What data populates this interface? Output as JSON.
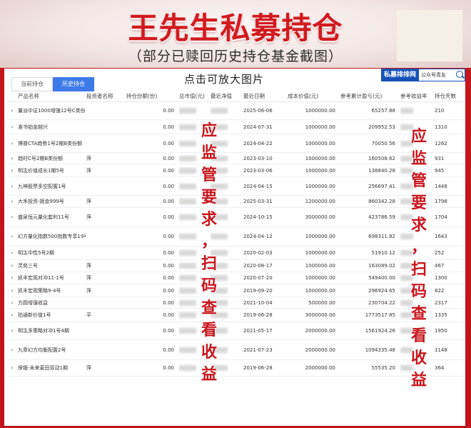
{
  "banner": {
    "title": "王先生私募持仓",
    "subtitle": "（部分已赎回历史持仓基金截图）"
  },
  "hint": "点击可放大图片",
  "tabs": [
    {
      "label": "当前持仓",
      "active": false
    },
    {
      "label": "历史持仓",
      "active": true
    }
  ],
  "search": {
    "logo": "私募排排网",
    "placeholder": "公众号青友"
  },
  "columns": [
    "产品名称",
    "投资者名称",
    "持仓份额(份)",
    "总市值(元)",
    "最近净值",
    "最近日期",
    "成本价值(元)",
    "参考累计盈亏(元)",
    "参考收益率",
    "持仓天数"
  ],
  "rows": [
    {
      "name": "量派中证1000增强12号C类份额",
      "investor": "",
      "shares": "0.00",
      "date": "2025-06-06",
      "cost": "1000000.00",
      "pnl": "65257.88",
      "days": "210"
    },
    {
      "name": "准书铂金越兴",
      "investor": "",
      "shares": "0.00",
      "date": "2024-07-31",
      "cost": "1000000.00",
      "pnl": "209952.53",
      "days": "1310"
    },
    {
      "name": "博普CTA趋势1号2期B类份额",
      "investor": "",
      "shares": "0.00",
      "date": "2024-04-22",
      "cost": "1000000.00",
      "pnl": "70050.56",
      "days": "1262"
    },
    {
      "name": "趋时C号2期B类份额",
      "investor": "萍",
      "shares": "0.00",
      "date": "2023-03-10",
      "cost": "1000000.00",
      "pnl": "160508.62",
      "days": "931"
    },
    {
      "name": "明汯价值成长1期5号",
      "investor": "萍",
      "shares": "0.00",
      "date": "2023-03-06",
      "cost": "1000000.00",
      "pnl": "138840.28",
      "days": "945"
    },
    {
      "name": "九坤股票多空配置1号",
      "investor": "",
      "shares": "0.00",
      "date": "2024-04-15",
      "cost": "1000000.00",
      "pnl": "256697.41",
      "days": "1448"
    },
    {
      "name": "大禾投资-掘金999号",
      "investor": "萍",
      "shares": "0.00",
      "date": "2025-03-31",
      "cost": "1200000.00",
      "pnl": "860342.28",
      "days": "1798"
    },
    {
      "name": "盛泉恒元量化套利11号",
      "investor": "萍",
      "shares": "0.00",
      "date": "2024-10-15",
      "cost": "3000000.00",
      "pnl": "423786.59",
      "days": "1704"
    },
    {
      "name": "幻方量化指数500指数专享19号1期",
      "investor": "",
      "shares": "0.00",
      "date": "2024-04-12",
      "cost": "1000000.00",
      "pnl": "698311.82",
      "days": "1643"
    },
    {
      "name": "明汯中性5号2期",
      "investor": "",
      "shares": "0.00",
      "date": "2020-02-03",
      "cost": "1000000.00",
      "pnl": "51910.12",
      "days": "252"
    },
    {
      "name": "灵奕三号",
      "investor": "萍",
      "shares": "0.00",
      "date": "2020-08-17",
      "cost": "1000000.00",
      "pnl": "163089.02",
      "days": "467"
    },
    {
      "name": "凯丰宏观对冲11-1号",
      "investor": "萍",
      "shares": "0.00",
      "date": "2020-07-20",
      "cost": "1000000.00",
      "pnl": "549400.00",
      "days": "1300"
    },
    {
      "name": "凯丰宏观策略9-4号",
      "investor": "萍",
      "shares": "0.00",
      "date": "2019-09-20",
      "cost": "1000000.00",
      "pnl": "296924.65",
      "days": "822"
    },
    {
      "name": "方圆增强收益",
      "investor": "",
      "shares": "0.00",
      "date": "2021-10-04",
      "cost": "500000.00",
      "pnl": "230704.22",
      "days": "2317"
    },
    {
      "name": "珀通新价值1号",
      "investor": "平",
      "shares": "0.00",
      "date": "2019-06-28",
      "cost": "3000000.00",
      "pnl": "1773517.85",
      "days": "1335"
    },
    {
      "name": "明汯多策略对冲1号4期",
      "investor": "",
      "shares": "0.00",
      "date": "2021-05-17",
      "cost": "2000000.00",
      "pnl": "1561924.26",
      "days": "1950"
    },
    {
      "name": "九章幻方均衡配置2号",
      "investor": "",
      "shares": "0.00",
      "date": "2021-07-23",
      "cost": "2000000.00",
      "pnl": "1094335.48",
      "days": "1148"
    },
    {
      "name": "保银-未来麦田双动1期",
      "investor": "萍",
      "shares": "0.00",
      "date": "2019-06-28",
      "cost": "2000000.00",
      "pnl": "55535.20",
      "days": "364"
    }
  ],
  "stamp_text": [
    "应",
    "监",
    "管",
    "要",
    "求",
    "，",
    "扫",
    "码",
    "查",
    "看",
    "收",
    "益"
  ],
  "colors": {
    "brand_red": "#d21a1f",
    "tab_blue": "#3e7be9",
    "link_blue": "#2e6fd8"
  }
}
